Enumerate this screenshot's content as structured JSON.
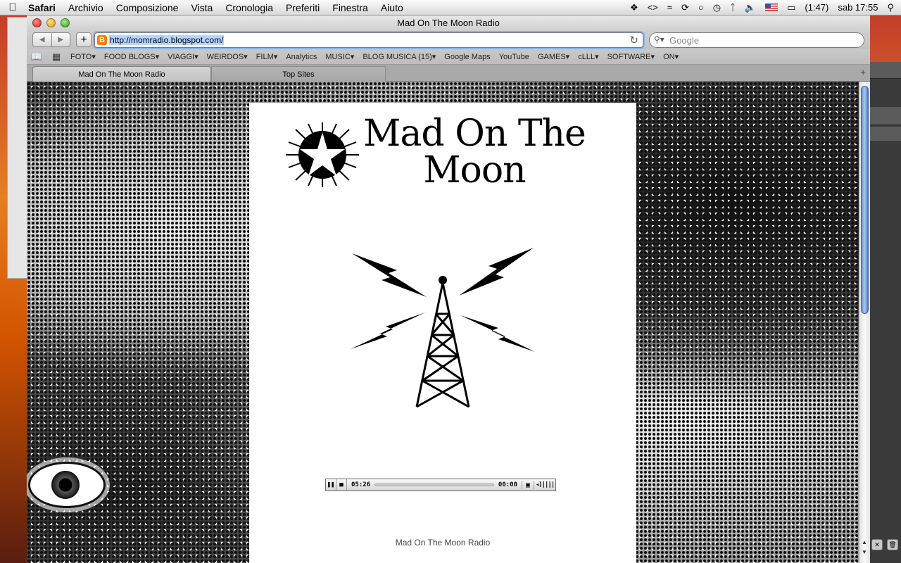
{
  "menubar": {
    "app_name": "Safari",
    "items": [
      "Archivio",
      "Composizione",
      "Vista",
      "Cronologia",
      "Preferiti",
      "Finestra",
      "Aiuto"
    ],
    "battery": "(1:47)",
    "clock": "sab 17:55"
  },
  "window": {
    "title": "Mad On The Moon Radio",
    "url": "http://momradio.blogspot.com/",
    "search_placeholder": "Google",
    "add_label": "+"
  },
  "bookmarks": [
    {
      "label": "FOTO",
      "menu": true
    },
    {
      "label": "FOOD BLOGS",
      "menu": true
    },
    {
      "label": "VIAGGI",
      "menu": true
    },
    {
      "label": "WEIRDOS",
      "menu": true
    },
    {
      "label": "FILM",
      "menu": true
    },
    {
      "label": "Analytics",
      "menu": false
    },
    {
      "label": "MUSIC",
      "menu": true
    },
    {
      "label": "BLOG MUSICA (15)",
      "menu": true
    },
    {
      "label": "Google Maps",
      "menu": false
    },
    {
      "label": "YouTube",
      "menu": false
    },
    {
      "label": "GAMES",
      "menu": true
    },
    {
      "label": "cLLL",
      "menu": true
    },
    {
      "label": "SOFTWARE",
      "menu": true
    },
    {
      "label": "ON",
      "menu": true
    }
  ],
  "tabs": [
    {
      "label": "Mad On The Moon Radio",
      "active": true
    },
    {
      "label": "Top Sites",
      "active": false
    }
  ],
  "page": {
    "title_line1": "Mad On The",
    "title_line2": "Moon",
    "footer": "Mad On The Moon Radio"
  },
  "player": {
    "elapsed": "05:26",
    "remaining": "00:00",
    "progress": 0
  },
  "colors": {
    "accent": "#3b62a5",
    "blogger_orange": "#f57d00",
    "url_highlight": "#b5d5ff"
  }
}
